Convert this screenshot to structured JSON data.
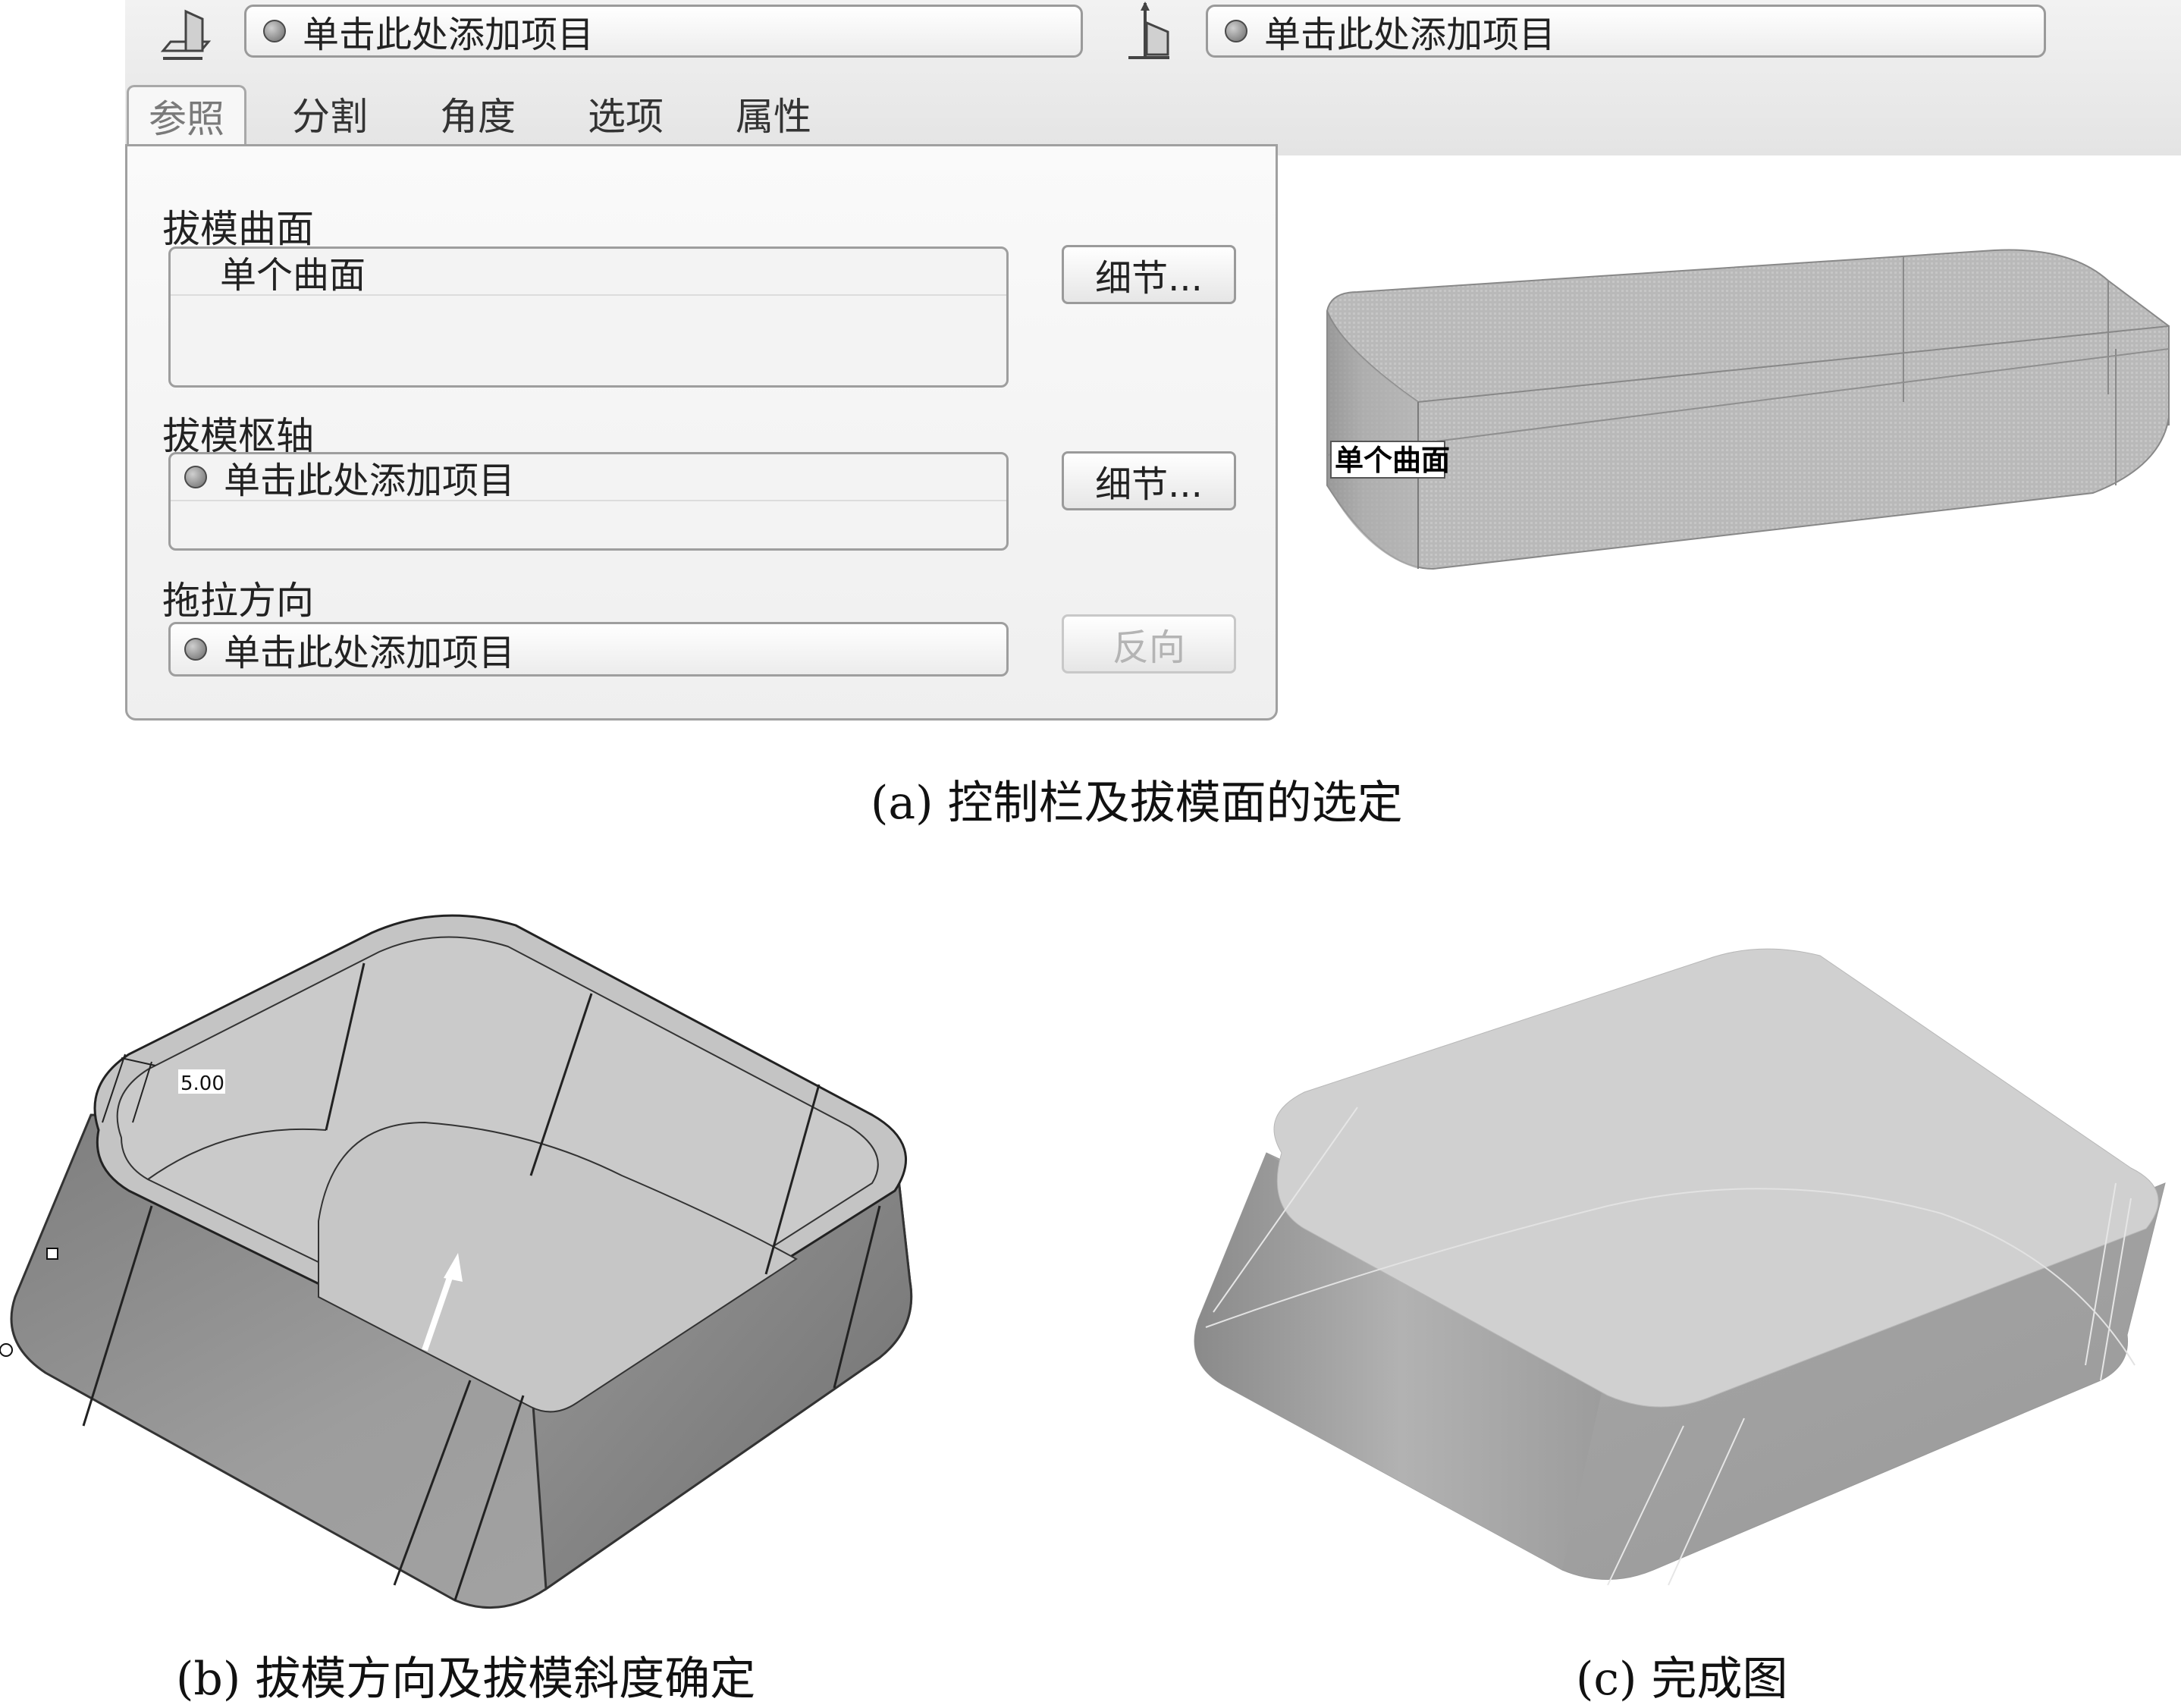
{
  "toolbar": {
    "surface_collector_placeholder": "单击此处添加项目",
    "direction_collector_placeholder": "单击此处添加项目"
  },
  "tabs": [
    {
      "label": "参照",
      "active": true
    },
    {
      "label": "分割",
      "active": false
    },
    {
      "label": "角度",
      "active": false
    },
    {
      "label": "选项",
      "active": false
    },
    {
      "label": "属性",
      "active": false
    }
  ],
  "panel": {
    "draft_surface": {
      "label": "拔模曲面",
      "value": "单个曲面",
      "button": "细节..."
    },
    "draft_hinge": {
      "label": "拔模枢轴",
      "placeholder": "单击此处添加项目",
      "button": "细节..."
    },
    "pull_direction": {
      "label": "拖拉方向",
      "placeholder": "单击此处添加项目",
      "button": "反向",
      "button_enabled": false
    }
  },
  "viewport_a": {
    "surface_tag": "单个曲面"
  },
  "viewport_b": {
    "dimension": "5.00"
  },
  "captions": {
    "a": "(a) 控制栏及拔模面的选定",
    "b": "(b) 拔模方向及拔模斜度确定",
    "c": "(c) 完成图"
  },
  "colors": {
    "ui_bg": "#efefef",
    "border": "#9e9e9e",
    "model_gray": "#a8a8a8"
  }
}
